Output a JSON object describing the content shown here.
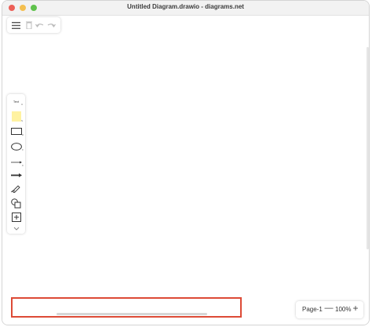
{
  "window": {
    "title": "Untitled Diagram.drawio - diagrams.net"
  },
  "toolbar": {
    "menu_icon": "hamburger-menu-icon",
    "delete_icon": "trash-icon",
    "undo_icon": "undo-icon",
    "redo_icon": "redo-icon"
  },
  "shapes_panel": {
    "text_label": "Text",
    "text_shortcut": "A",
    "note_shortcut": "S",
    "rectangle_shortcut": "D",
    "ellipse_shortcut": "F",
    "line_shortcut": "C"
  },
  "zoom": {
    "page_label": "Page-1",
    "zoom_out_label": "—",
    "zoom_level": "100%",
    "zoom_in_label": "+"
  },
  "colors": {
    "highlight": "#dd4a36",
    "sticky_note": "#fff2a1"
  }
}
